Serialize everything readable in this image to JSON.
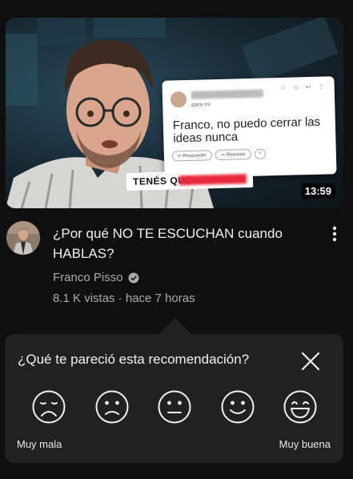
{
  "video": {
    "duration": "13:59",
    "thumbnail": {
      "card_meta": "para mí",
      "card_message": "Franco, no puedo cerrar las ideas nunca",
      "card_actions": [
        "Responder",
        "Reenviar"
      ],
      "overlay_text": "TENÉS QUE"
    },
    "title": "¿Por qué NO TE ESCUCHAN cuando HABLAS?",
    "channel": "Franco Pisso",
    "stats": "8.1 K vistas · hace 7 horas",
    "more_icon": "more-vert-icon",
    "verified_icon": "verified-check-icon"
  },
  "survey": {
    "question": "¿Qué te pareció esta recomendación?",
    "close_icon": "close-icon",
    "options": [
      "very-bad-face-icon",
      "bad-face-icon",
      "neutral-face-icon",
      "good-face-icon",
      "very-good-face-icon"
    ],
    "label_low": "Muy mala",
    "label_high": "Muy buena"
  }
}
